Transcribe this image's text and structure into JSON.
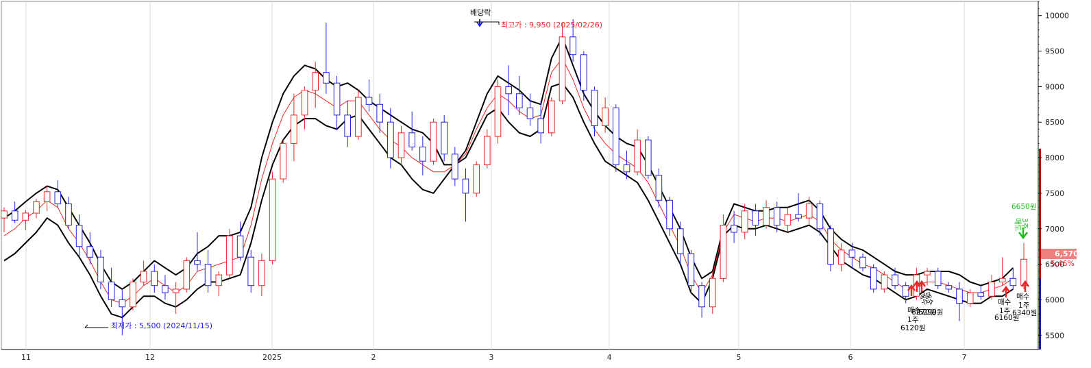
{
  "chart_data": {
    "type": "candlestick",
    "y_range": [
      5300,
      10200
    ],
    "y_ticks": [
      5500,
      6000,
      6500,
      7000,
      7500,
      8000,
      8500,
      9000,
      9500,
      10000
    ],
    "x_labels": [
      "11",
      "12",
      "2025",
      "2",
      "3",
      "4",
      "5",
      "6",
      "7"
    ],
    "colors": {
      "up": "#e8262a",
      "down": "#2222dd",
      "band": "#000000",
      "mid": "#e8262a",
      "buy": "#e8262a",
      "sell": "#22bb22"
    },
    "candles": [
      {
        "o": 7150,
        "h": 7300,
        "l": 6950,
        "c": 7250
      },
      {
        "o": 7250,
        "h": 7380,
        "l": 7080,
        "c": 7120
      },
      {
        "o": 7120,
        "h": 7260,
        "l": 6980,
        "c": 7220
      },
      {
        "o": 7220,
        "h": 7420,
        "l": 7150,
        "c": 7380
      },
      {
        "o": 7380,
        "h": 7600,
        "l": 7250,
        "c": 7520
      },
      {
        "o": 7520,
        "h": 7680,
        "l": 7300,
        "c": 7350
      },
      {
        "o": 7350,
        "h": 7450,
        "l": 7000,
        "c": 7050
      },
      {
        "o": 7050,
        "h": 7200,
        "l": 6600,
        "c": 6750
      },
      {
        "o": 6750,
        "h": 6950,
        "l": 6500,
        "c": 6600
      },
      {
        "o": 6600,
        "h": 6700,
        "l": 6150,
        "c": 6250
      },
      {
        "o": 6250,
        "h": 6450,
        "l": 5900,
        "c": 6000
      },
      {
        "o": 6000,
        "h": 6150,
        "l": 5500,
        "c": 5900
      },
      {
        "o": 5900,
        "h": 6300,
        "l": 5850,
        "c": 6250
      },
      {
        "o": 6250,
        "h": 6550,
        "l": 6200,
        "c": 6400
      },
      {
        "o": 6400,
        "h": 6500,
        "l": 6100,
        "c": 6200
      },
      {
        "o": 6200,
        "h": 6350,
        "l": 6000,
        "c": 6100
      },
      {
        "o": 6100,
        "h": 6250,
        "l": 5800,
        "c": 6150
      },
      {
        "o": 6150,
        "h": 6600,
        "l": 6100,
        "c": 6550
      },
      {
        "o": 6550,
        "h": 6950,
        "l": 6400,
        "c": 6500
      },
      {
        "o": 6500,
        "h": 6700,
        "l": 6100,
        "c": 6200
      },
      {
        "o": 6200,
        "h": 6400,
        "l": 6050,
        "c": 6350
      },
      {
        "o": 6350,
        "h": 7000,
        "l": 6300,
        "c": 6900
      },
      {
        "o": 6900,
        "h": 7100,
        "l": 6550,
        "c": 6600
      },
      {
        "o": 6600,
        "h": 6700,
        "l": 6100,
        "c": 6200
      },
      {
        "o": 6200,
        "h": 6650,
        "l": 6050,
        "c": 6550
      },
      {
        "o": 6550,
        "h": 7800,
        "l": 6500,
        "c": 7700
      },
      {
        "o": 7700,
        "h": 8250,
        "l": 7650,
        "c": 8200
      },
      {
        "o": 8200,
        "h": 8900,
        "l": 7950,
        "c": 8600
      },
      {
        "o": 8600,
        "h": 9000,
        "l": 8400,
        "c": 8950
      },
      {
        "o": 8950,
        "h": 9350,
        "l": 8700,
        "c": 9200
      },
      {
        "o": 9200,
        "h": 9900,
        "l": 8900,
        "c": 9050
      },
      {
        "o": 9050,
        "h": 9150,
        "l": 8400,
        "c": 8600
      },
      {
        "o": 8600,
        "h": 8800,
        "l": 8150,
        "c": 8300
      },
      {
        "o": 8300,
        "h": 8950,
        "l": 8250,
        "c": 8850
      },
      {
        "o": 8850,
        "h": 9100,
        "l": 8650,
        "c": 8750
      },
      {
        "o": 8750,
        "h": 8900,
        "l": 8350,
        "c": 8500
      },
      {
        "o": 8500,
        "h": 8700,
        "l": 7850,
        "c": 8000
      },
      {
        "o": 8000,
        "h": 8450,
        "l": 7900,
        "c": 8350
      },
      {
        "o": 8350,
        "h": 8650,
        "l": 8100,
        "c": 8150
      },
      {
        "o": 8150,
        "h": 8300,
        "l": 7750,
        "c": 7950
      },
      {
        "o": 7950,
        "h": 8550,
        "l": 7900,
        "c": 8500
      },
      {
        "o": 8500,
        "h": 8600,
        "l": 7950,
        "c": 8050
      },
      {
        "o": 8050,
        "h": 8150,
        "l": 7600,
        "c": 7700
      },
      {
        "o": 7700,
        "h": 7850,
        "l": 7100,
        "c": 7500
      },
      {
        "o": 7500,
        "h": 7950,
        "l": 7450,
        "c": 7900
      },
      {
        "o": 7900,
        "h": 8400,
        "l": 7850,
        "c": 8300
      },
      {
        "o": 8300,
        "h": 9100,
        "l": 8200,
        "c": 9000
      },
      {
        "o": 9000,
        "h": 9300,
        "l": 8600,
        "c": 8900
      },
      {
        "o": 8900,
        "h": 9150,
        "l": 8600,
        "c": 8700
      },
      {
        "o": 8700,
        "h": 8900,
        "l": 8450,
        "c": 8550
      },
      {
        "o": 8550,
        "h": 8800,
        "l": 8200,
        "c": 8350
      },
      {
        "o": 8350,
        "h": 8850,
        "l": 8300,
        "c": 8800
      },
      {
        "o": 8800,
        "h": 9900,
        "l": 8750,
        "c": 9700
      },
      {
        "o": 9700,
        "h": 9950,
        "l": 9350,
        "c": 9450
      },
      {
        "o": 9450,
        "h": 9500,
        "l": 8800,
        "c": 8950
      },
      {
        "o": 8950,
        "h": 9000,
        "l": 8300,
        "c": 8450
      },
      {
        "o": 8450,
        "h": 8850,
        "l": 8350,
        "c": 8700
      },
      {
        "o": 8700,
        "h": 8750,
        "l": 7800,
        "c": 7900
      },
      {
        "o": 7900,
        "h": 8100,
        "l": 7700,
        "c": 7800
      },
      {
        "o": 7800,
        "h": 8400,
        "l": 7750,
        "c": 8250
      },
      {
        "o": 8250,
        "h": 8300,
        "l": 7700,
        "c": 7750
      },
      {
        "o": 7750,
        "h": 7850,
        "l": 7300,
        "c": 7400
      },
      {
        "o": 7400,
        "h": 7450,
        "l": 6900,
        "c": 7000
      },
      {
        "o": 7000,
        "h": 7100,
        "l": 6500,
        "c": 6650
      },
      {
        "o": 6650,
        "h": 6700,
        "l": 6100,
        "c": 6200
      },
      {
        "o": 6200,
        "h": 6250,
        "l": 5750,
        "c": 5900
      },
      {
        "o": 5900,
        "h": 6400,
        "l": 5800,
        "c": 6300
      },
      {
        "o": 6300,
        "h": 7200,
        "l": 6250,
        "c": 7050
      },
      {
        "o": 7050,
        "h": 7250,
        "l": 6800,
        "c": 6950
      },
      {
        "o": 6950,
        "h": 7350,
        "l": 6850,
        "c": 7250
      },
      {
        "o": 7250,
        "h": 7350,
        "l": 6900,
        "c": 7050
      },
      {
        "o": 7050,
        "h": 7400,
        "l": 7000,
        "c": 7300
      },
      {
        "o": 7300,
        "h": 7380,
        "l": 6950,
        "c": 7050
      },
      {
        "o": 7050,
        "h": 7300,
        "l": 6950,
        "c": 7200
      },
      {
        "o": 7200,
        "h": 7500,
        "l": 7100,
        "c": 7150
      },
      {
        "o": 7150,
        "h": 7450,
        "l": 7050,
        "c": 7350
      },
      {
        "o": 7350,
        "h": 7400,
        "l": 6900,
        "c": 7000
      },
      {
        "o": 7000,
        "h": 7050,
        "l": 6400,
        "c": 6500
      },
      {
        "o": 6500,
        "h": 6800,
        "l": 6400,
        "c": 6700
      },
      {
        "o": 6700,
        "h": 6800,
        "l": 6450,
        "c": 6600
      },
      {
        "o": 6600,
        "h": 6650,
        "l": 6400,
        "c": 6450
      },
      {
        "o": 6450,
        "h": 6500,
        "l": 6100,
        "c": 6150
      },
      {
        "o": 6150,
        "h": 6400,
        "l": 6100,
        "c": 6350
      },
      {
        "o": 6350,
        "h": 6450,
        "l": 6150,
        "c": 6200
      },
      {
        "o": 6200,
        "h": 6250,
        "l": 5950,
        "c": 6050
      },
      {
        "o": 6050,
        "h": 6450,
        "l": 6000,
        "c": 6350
      },
      {
        "o": 6350,
        "h": 6450,
        "l": 6200,
        "c": 6400
      },
      {
        "o": 6400,
        "h": 6450,
        "l": 6150,
        "c": 6200
      },
      {
        "o": 6200,
        "h": 6250,
        "l": 6100,
        "c": 6150
      },
      {
        "o": 6150,
        "h": 6250,
        "l": 5700,
        "c": 5950
      },
      {
        "o": 5950,
        "h": 6150,
        "l": 5900,
        "c": 6100
      },
      {
        "o": 6100,
        "h": 6200,
        "l": 6000,
        "c": 6050
      },
      {
        "o": 6050,
        "h": 6350,
        "l": 6000,
        "c": 6250
      },
      {
        "o": 6250,
        "h": 6600,
        "l": 6200,
        "c": 6300
      },
      {
        "o": 6300,
        "h": 6450,
        "l": 6150,
        "c": 6200
      },
      {
        "o": 6200,
        "h": 6800,
        "l": 6150,
        "c": 6570
      }
    ],
    "upper_band": [
      7150,
      7250,
      7380,
      7500,
      7600,
      7550,
      7300,
      7050,
      6800,
      6500,
      6250,
      6150,
      6250,
      6400,
      6550,
      6450,
      6350,
      6450,
      6650,
      6750,
      6900,
      6900,
      6950,
      7300,
      8000,
      8500,
      8900,
      9150,
      9300,
      9250,
      9100,
      9000,
      9050,
      8950,
      8800,
      8700,
      8600,
      8500,
      8400,
      8350,
      8200,
      7900,
      7900,
      8100,
      8500,
      8900,
      9150,
      9050,
      8950,
      8800,
      8750,
      9400,
      9700,
      9300,
      8900,
      8650,
      8450,
      8300,
      8200,
      8150,
      7900,
      7600,
      7300,
      7000,
      6600,
      6300,
      6400,
      7000,
      7350,
      7300,
      7250,
      7250,
      7300,
      7300,
      7350,
      7400,
      7250,
      7000,
      6850,
      6750,
      6700,
      6600,
      6500,
      6400,
      6350,
      6350,
      6400,
      6400,
      6400,
      6350,
      6250,
      6200,
      6250,
      6300,
      6450
    ],
    "lower_band": [
      6550,
      6650,
      6800,
      6950,
      7150,
      7050,
      6800,
      6600,
      6350,
      6050,
      5800,
      5750,
      5900,
      6050,
      6050,
      5950,
      5900,
      6000,
      6150,
      6250,
      6250,
      6300,
      6350,
      6800,
      7400,
      7900,
      8250,
      8450,
      8550,
      8550,
      8450,
      8400,
      8550,
      8600,
      8400,
      8200,
      8000,
      7900,
      7700,
      7550,
      7500,
      7700,
      7900,
      8000,
      8300,
      8600,
      8700,
      8500,
      8350,
      8300,
      8400,
      9000,
      9050,
      8850,
      8500,
      8200,
      7950,
      7850,
      7750,
      7650,
      7400,
      7100,
      6800,
      6500,
      6100,
      5950,
      6300,
      6900,
      7050,
      7000,
      7000,
      7050,
      7000,
      6950,
      7000,
      7050,
      6950,
      6750,
      6550,
      6450,
      6350,
      6300,
      6200,
      6100,
      6000,
      6050,
      6150,
      6100,
      6050,
      6000,
      5950,
      5950,
      6050,
      6050,
      6150
    ],
    "mid_line": [
      6900,
      7000,
      7150,
      7250,
      7400,
      7300,
      7000,
      6800,
      6550,
      6250,
      6000,
      5950,
      6050,
      6200,
      6300,
      6200,
      6100,
      6200,
      6400,
      6450,
      6500,
      6550,
      6600,
      7050,
      7700,
      8200,
      8600,
      8850,
      8950,
      8900,
      8800,
      8700,
      8800,
      8800,
      8600,
      8400,
      8250,
      8150,
      8000,
      7900,
      7800,
      7800,
      7900,
      8050,
      8400,
      8700,
      8900,
      8800,
      8650,
      8550,
      8600,
      9200,
      9400,
      9100,
      8700,
      8400,
      8200,
      8050,
      7950,
      7850,
      7650,
      7350,
      7050,
      6750,
      6350,
      6100,
      6350,
      6950,
      7200,
      7150,
      7100,
      7150,
      7150,
      7100,
      7150,
      7200,
      7100,
      6850,
      6700,
      6600,
      6500,
      6450,
      6350,
      6250,
      6150,
      6200,
      6250,
      6250,
      6200,
      6150,
      6100,
      6100,
      6150,
      6200,
      6300
    ],
    "annotations": {
      "dividend": "배당락",
      "high": "최고가 : 9,950 (2025/02/26)",
      "low": "최저가 : 5,500 (2024/11/15)",
      "last_price": "6,570",
      "last_change": "5.46%",
      "sell_signal": {
        "price": "6650원",
        "label": "매도",
        "qty": "3주"
      },
      "buy_signals": [
        {
          "action": "매수",
          "qty": "1주",
          "price": "6120원"
        },
        {
          "action": "매수",
          "qty": "",
          "price": "6290원"
        },
        {
          "action": "매수",
          "qty": "",
          "price": "6270원"
        },
        {
          "action": "매수",
          "qty": "1주",
          "price": "6160원"
        },
        {
          "action": "매수",
          "qty": "1주",
          "price": "6340원"
        }
      ]
    }
  }
}
